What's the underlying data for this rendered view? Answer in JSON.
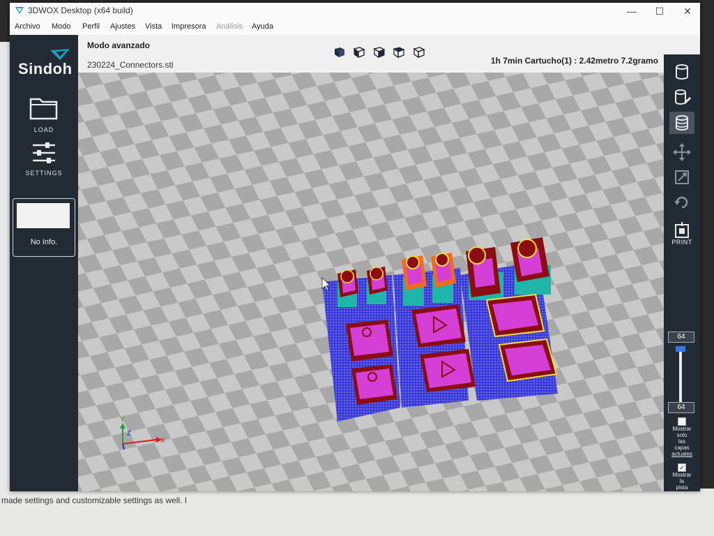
{
  "window": {
    "title": "3DWOX Desktop (x64 build)",
    "minimize": "—",
    "maximize": "☐",
    "close": "✕"
  },
  "menu": [
    {
      "label": "Archivo",
      "enabled": true
    },
    {
      "label": "Modo",
      "enabled": true
    },
    {
      "label": "Perfil",
      "enabled": true
    },
    {
      "label": "Ajustes",
      "enabled": true
    },
    {
      "label": "Vista",
      "enabled": true
    },
    {
      "label": "Impresora",
      "enabled": true
    },
    {
      "label": "Análisis",
      "enabled": false
    },
    {
      "label": "Ayuda",
      "enabled": true
    }
  ],
  "sidebar": {
    "brand": "Sindoh",
    "load_label": "LOAD",
    "settings_label": "SETTINGS",
    "info_text": "No Info."
  },
  "header": {
    "mode": "Modo avanzado",
    "file": "230224_Connectors.stl",
    "print_info": "1h 7min  Cartucho(1) : 2.42metro 7.2gramo"
  },
  "view_cubes": [
    "view-solid-icon",
    "view-front-icon",
    "view-side-icon",
    "view-top-icon",
    "view-iso-icon"
  ],
  "right_bar": {
    "print_label": "PRINT",
    "layer_max": "64",
    "layer_current": "64",
    "layer_fraction": 1.0,
    "only_current_label": [
      "Mostrar",
      "solo",
      "las",
      "capas",
      "actuales"
    ],
    "only_current_checked": false,
    "show_track_label": [
      "Mostrar",
      "la",
      "pista"
    ],
    "show_track_checked": true
  },
  "axis": {
    "x": "X",
    "y": "Y",
    "z": "Z"
  },
  "colors": {
    "sidebar": "#222a33",
    "brim": "#3a3ad8",
    "wall": "#8b0d12",
    "infill": "#d63fd6",
    "support": "#1fb5a8",
    "skin": "#f2e030",
    "accent": "#2c7be5"
  },
  "background_text": "made settings and customizable settings as well. I"
}
